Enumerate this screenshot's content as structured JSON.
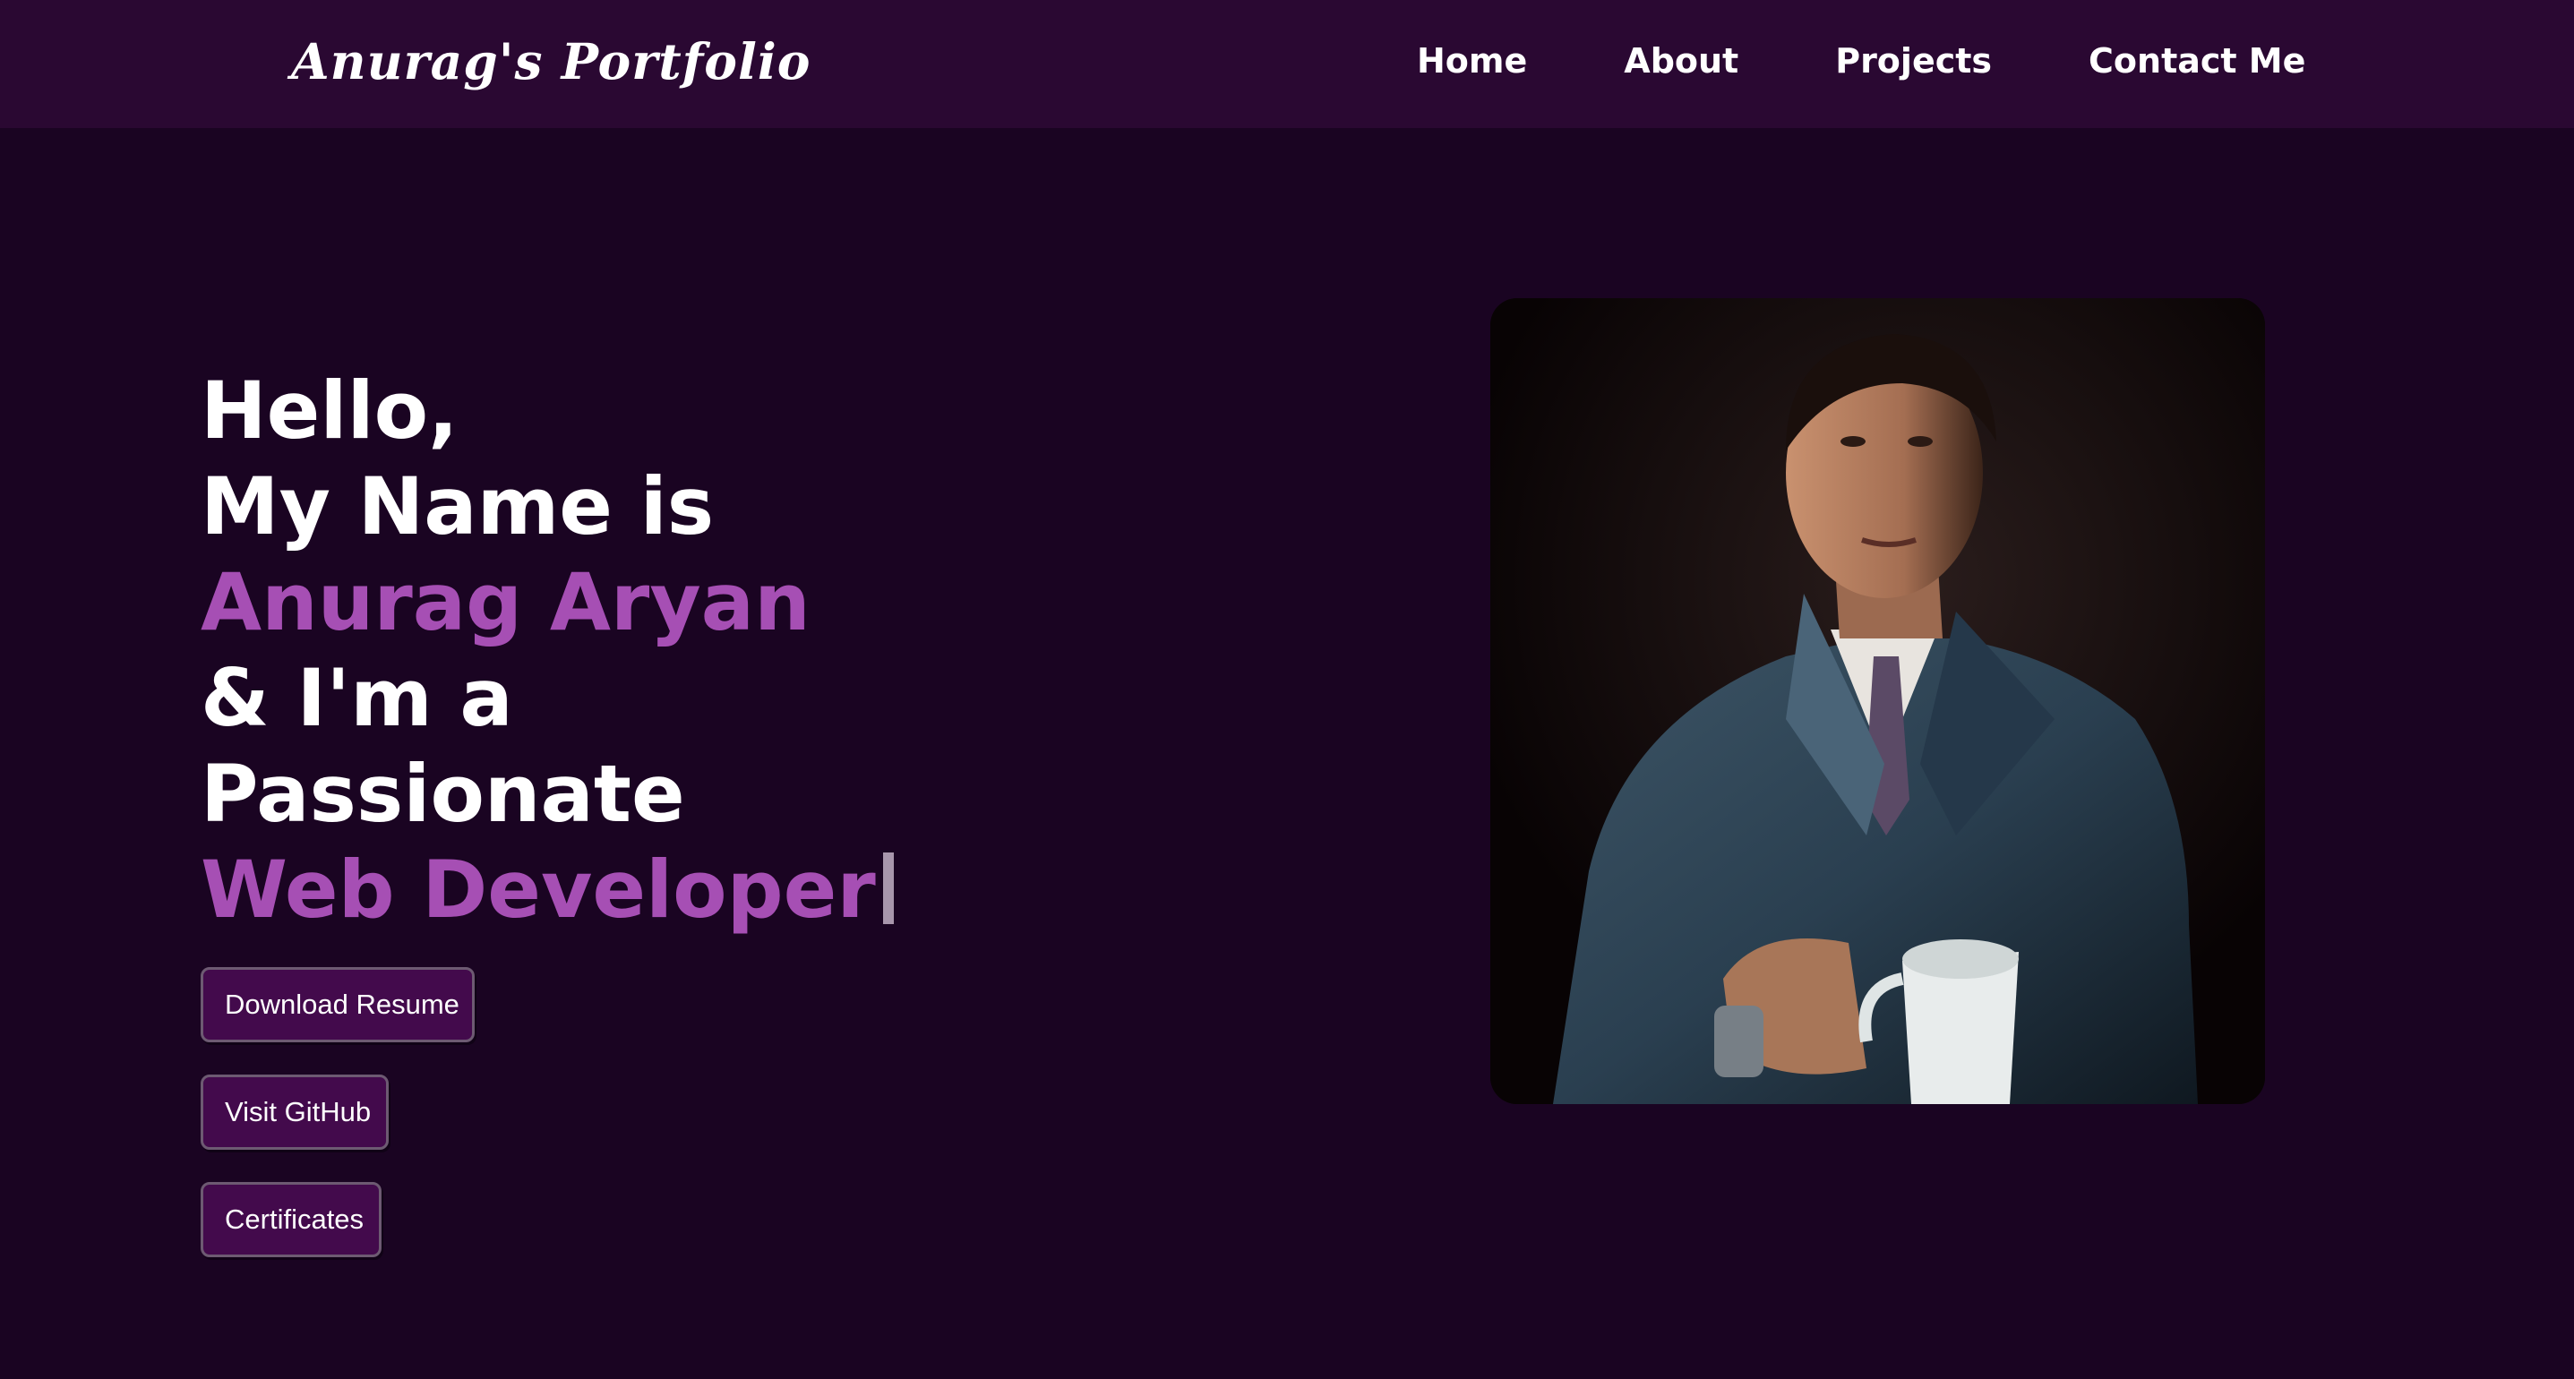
{
  "nav": {
    "logo": "Anurag's Portfolio",
    "links": [
      "Home",
      "About",
      "Projects",
      "Contact Me"
    ]
  },
  "hero": {
    "line1": "Hello,",
    "line2": "My Name is",
    "name": "Anurag Aryan",
    "line4": "& I'm a",
    "line5": "Passionate",
    "role": "Web Developer"
  },
  "buttons": {
    "resume": "Download Resume",
    "github": "Visit GitHub",
    "certificates": "Certificates"
  },
  "colors": {
    "background": "#1a0422",
    "navbar": "#2a0832",
    "accent": "#a64fb4",
    "button": "#430a4c"
  }
}
